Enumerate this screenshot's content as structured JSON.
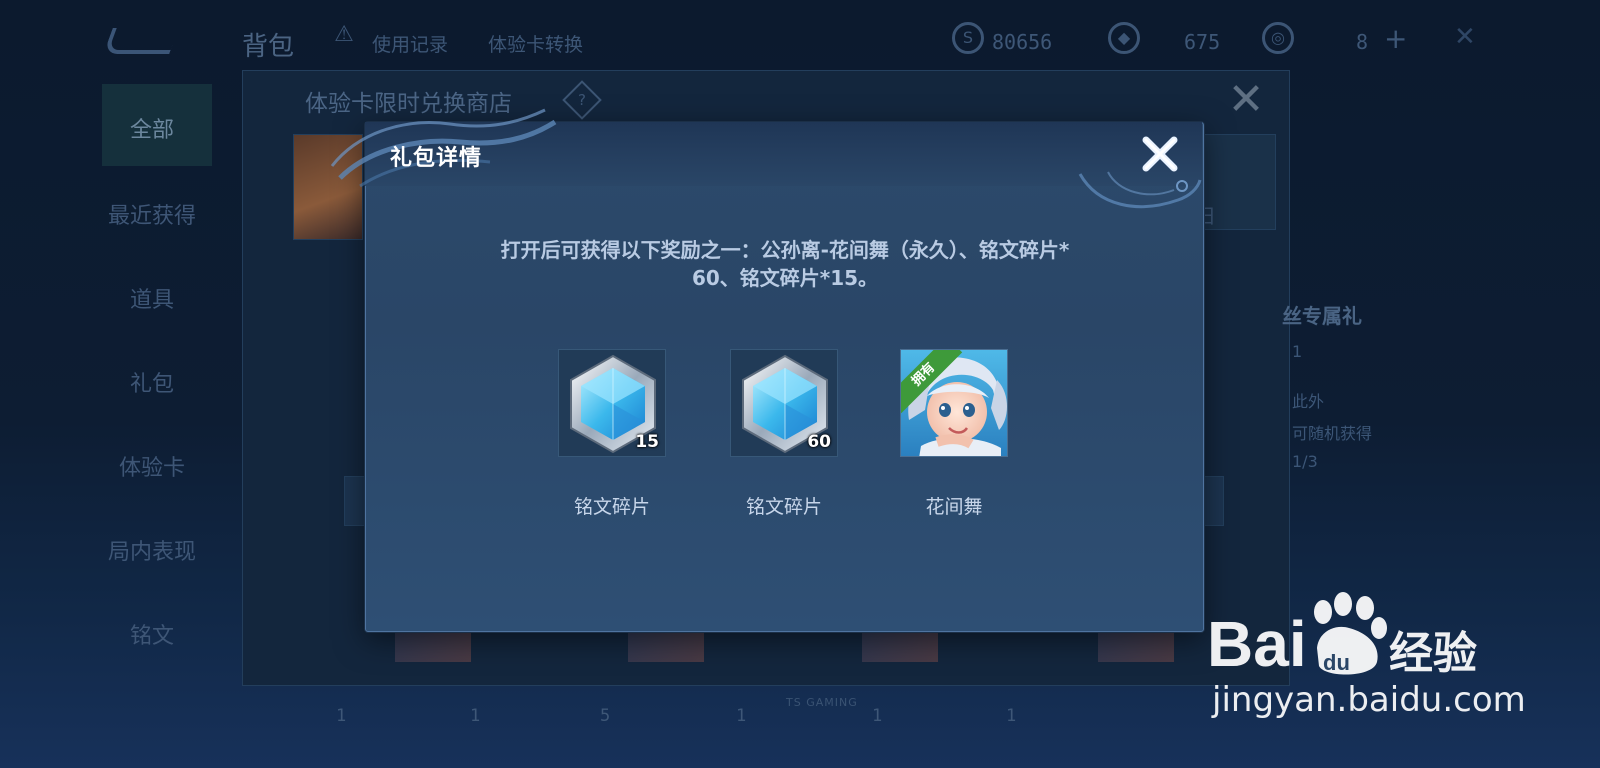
{
  "background": {
    "bag_title": "背包",
    "links": [
      "使用记录",
      "体验卡转换"
    ],
    "currency": [
      {
        "icon": "coin-icon",
        "value": "80656"
      },
      {
        "icon": "diamond-icon",
        "value": "675"
      },
      {
        "icon": "token-icon",
        "value": "8"
      }
    ],
    "sidebar": [
      "全部",
      "最近获得",
      "道具",
      "礼包",
      "体验卡",
      "局内表现",
      "铭文"
    ],
    "shop_title": "体验卡限时兑换商店",
    "right_panel": {
      "heading": "丝专属礼",
      "lines": [
        "1",
        "此外",
        "可随机获得",
        "1/3"
      ]
    },
    "bottom_counts": [
      "1",
      "1",
      "5",
      "1",
      "1",
      "1"
    ],
    "bottom_tag": "TS GAMING"
  },
  "modal": {
    "title": "礼包详情",
    "description_line1": "打开后可获得以下奖励之一：公孙离-花间舞（永久）、铭文碎片*",
    "description_line2": "60、铭文碎片*15。",
    "rewards": [
      {
        "name": "铭文碎片",
        "count": "15",
        "icon": "inscription-fragment-icon"
      },
      {
        "name": "铭文碎片",
        "count": "60",
        "icon": "inscription-fragment-icon"
      },
      {
        "name": "花间舞",
        "badge": "拥有",
        "icon": "skin-portrait-icon"
      }
    ]
  },
  "watermark": {
    "brand": "Bai du 经验",
    "url": "jingyan.baidu.com"
  },
  "colors": {
    "modal_bg": "#2c4a6b",
    "modal_border": "#4f74a0",
    "owned_badge": "#3e9a3a"
  }
}
